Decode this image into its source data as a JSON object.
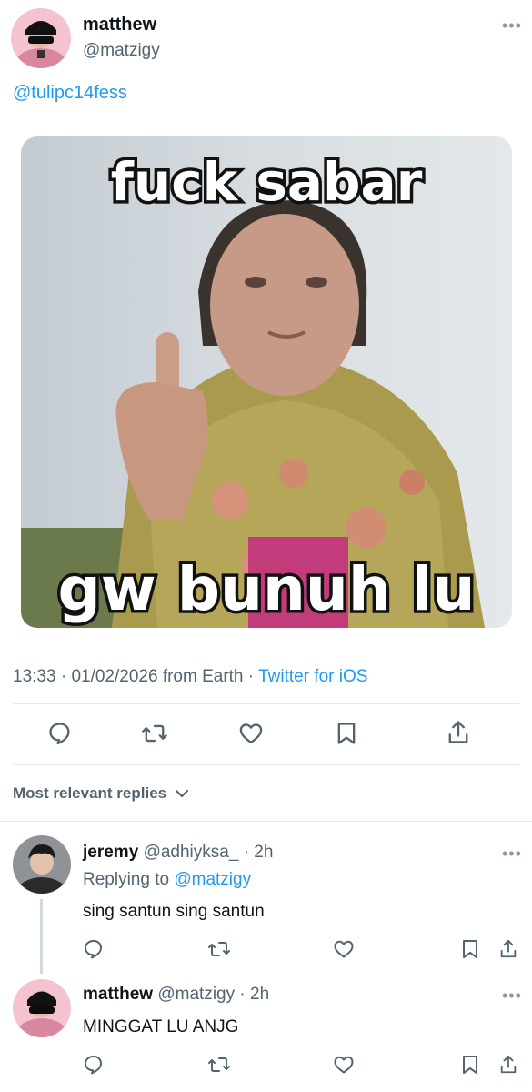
{
  "tweet": {
    "author_name": "matthew",
    "author_handle": "@matzigy",
    "reply_to": "@tulipc14fess",
    "image_caption_top": "fuck sabar",
    "image_caption_bottom": "gw bunuh lu",
    "time": "13:33",
    "date": "01/02/2026",
    "location": "from Earth",
    "source": "Twitter for iOS",
    "more_icon": "ellipsis-icon"
  },
  "actions": [
    "reply-icon",
    "retweet-icon",
    "like-icon",
    "bookmark-icon",
    "share-icon"
  ],
  "replies_filter": {
    "label": "Most relevant replies"
  },
  "replies": [
    {
      "name": "jeremy",
      "handle": "@adhiyksa_",
      "time": "2h",
      "replying_prefix": "Replying to",
      "replying_to": "@matzigy",
      "text": "sing santun sing santun"
    },
    {
      "name": "matthew",
      "handle": "@matzigy",
      "time": "2h",
      "text": "MINGGAT LU ANJG"
    }
  ],
  "colors": {
    "link": "#1d9bf0",
    "secondary": "#536471",
    "divider": "#e6e9ec"
  }
}
